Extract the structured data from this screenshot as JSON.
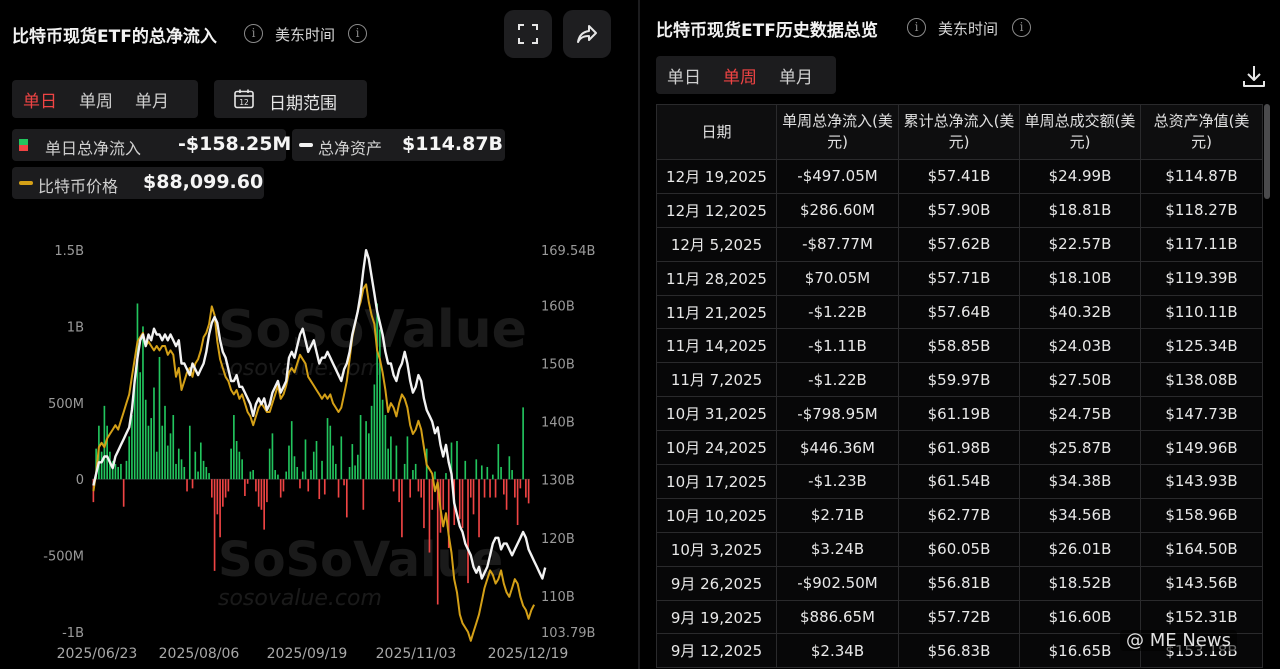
{
  "left": {
    "title": "比特币现货ETF的总净流入",
    "timezone": "美东时间",
    "tabs": [
      "单日",
      "单周",
      "单月"
    ],
    "active_tab": "单日",
    "date_range_label": "日期范围",
    "calendar_icon_text": "12",
    "legend": {
      "flow_label": "单日总净流入",
      "flow_value": "-$158.25M",
      "assets_label": "总净资产",
      "assets_value": "$114.87B",
      "price_label": "比特币价格",
      "price_value": "$88,099.60"
    },
    "watermark": "SoSoValue",
    "watermark_sub": "sosovalue.com"
  },
  "right": {
    "title": "比特币现货ETF历史数据总览",
    "timezone": "美东时间",
    "tabs": [
      "单日",
      "单周",
      "单月"
    ],
    "active_tab": "单周",
    "columns": [
      "日期",
      "单周总净流入(美元)",
      "累计总净流入(美元)",
      "单周总成交额(美元)",
      "总资产净值(美元)"
    ],
    "rows": [
      {
        "date": "12月 19,2025",
        "flow": "-$497.05M",
        "sign": "neg",
        "cum": "$57.41B",
        "vol": "$24.99B",
        "nav": "$114.87B"
      },
      {
        "date": "12月 12,2025",
        "flow": "$286.60M",
        "sign": "pos",
        "cum": "$57.90B",
        "vol": "$18.81B",
        "nav": "$118.27B"
      },
      {
        "date": "12月 5,2025",
        "flow": "-$87.77M",
        "sign": "neg",
        "cum": "$57.62B",
        "vol": "$22.57B",
        "nav": "$117.11B"
      },
      {
        "date": "11月 28,2025",
        "flow": "$70.05M",
        "sign": "pos",
        "cum": "$57.71B",
        "vol": "$18.10B",
        "nav": "$119.39B"
      },
      {
        "date": "11月 21,2025",
        "flow": "-$1.22B",
        "sign": "neg",
        "cum": "$57.64B",
        "vol": "$40.32B",
        "nav": "$110.11B"
      },
      {
        "date": "11月 14,2025",
        "flow": "-$1.11B",
        "sign": "neg",
        "cum": "$58.85B",
        "vol": "$24.03B",
        "nav": "$125.34B"
      },
      {
        "date": "11月 7,2025",
        "flow": "-$1.22B",
        "sign": "neg",
        "cum": "$59.97B",
        "vol": "$27.50B",
        "nav": "$138.08B"
      },
      {
        "date": "10月 31,2025",
        "flow": "-$798.95M",
        "sign": "neg",
        "cum": "$61.19B",
        "vol": "$24.75B",
        "nav": "$147.73B"
      },
      {
        "date": "10月 24,2025",
        "flow": "$446.36M",
        "sign": "pos",
        "cum": "$61.98B",
        "vol": "$25.87B",
        "nav": "$149.96B"
      },
      {
        "date": "10月 17,2025",
        "flow": "-$1.23B",
        "sign": "neg",
        "cum": "$61.54B",
        "vol": "$34.38B",
        "nav": "$143.93B"
      },
      {
        "date": "10月 10,2025",
        "flow": "$2.71B",
        "sign": "pos",
        "cum": "$62.77B",
        "vol": "$34.56B",
        "nav": "$158.96B"
      },
      {
        "date": "10月 3,2025",
        "flow": "$3.24B",
        "sign": "pos",
        "cum": "$60.05B",
        "vol": "$26.01B",
        "nav": "$164.50B"
      },
      {
        "date": "9月 26,2025",
        "flow": "-$902.50M",
        "sign": "neg",
        "cum": "$56.81B",
        "vol": "$18.52B",
        "nav": "$143.56B"
      },
      {
        "date": "9月 19,2025",
        "flow": "$886.65M",
        "sign": "pos",
        "cum": "$57.72B",
        "vol": "$16.60B",
        "nav": "$152.31B"
      },
      {
        "date": "9月 12,2025",
        "flow": "$2.34B",
        "sign": "pos",
        "cum": "$56.83B",
        "vol": "$16.65B",
        "nav": "$153.18B"
      }
    ],
    "watermark": "SoSoValue",
    "watermark_sub": "sosovalue.com",
    "credit": "@ ME News"
  },
  "colors": {
    "inflow": "#22c55e",
    "outflow": "#ef4444",
    "assets_line": "#f2f2f2",
    "price_line": "#d4a017",
    "accent_active": "#ef4444"
  },
  "chart_data": {
    "type": "bar",
    "x_ticks": [
      "2025/06/23",
      "2025/08/06",
      "2025/09/19",
      "2025/11/03",
      "2025/12/19"
    ],
    "left_axis_ticks": [
      "1.5B",
      "1B",
      "500M",
      "0",
      "-500M",
      "-1B"
    ],
    "left_ylim": [
      -1000,
      1500
    ],
    "left_unit": "M",
    "right_axis_ticks": [
      "169.54B",
      "160B",
      "150B",
      "140B",
      "130B",
      "120B",
      "110B",
      "103.79B"
    ],
    "right_axis_values": [
      169.54,
      160,
      150,
      140,
      130,
      120,
      110,
      103.79
    ],
    "right_ylim": [
      103.79,
      169.54
    ],
    "series": [
      {
        "name": "单日总净流入",
        "type": "bar",
        "unit": "M",
        "values": [
          -150,
          200,
          350,
          180,
          480,
          350,
          180,
          120,
          100,
          80,
          100,
          -180,
          120,
          280,
          420,
          620,
          1150,
          700,
          1000,
          520,
          350,
          400,
          600,
          180,
          800,
          350,
          480,
          220,
          300,
          420,
          100,
          200,
          130,
          80,
          -80,
          350,
          -60,
          180,
          50,
          240,
          120,
          80,
          40,
          -120,
          -600,
          -230,
          -380,
          -180,
          -120,
          -80,
          200,
          420,
          250,
          180,
          130,
          -110,
          -30,
          50,
          60,
          -80,
          -180,
          -200,
          -330,
          -150,
          200,
          300,
          60,
          30,
          -120,
          -80,
          50,
          220,
          380,
          150,
          80,
          -60,
          50,
          260,
          -80,
          60,
          180,
          250,
          -130,
          120,
          -100,
          400,
          350,
          220,
          100,
          -120,
          280,
          -40,
          -250,
          80,
          230,
          90,
          160,
          420,
          -200,
          380,
          300,
          480,
          620,
          1150,
          980,
          520,
          420,
          200,
          280,
          -80,
          220,
          -150,
          -380,
          100,
          280,
          -120,
          60,
          100,
          -80,
          -120,
          -320,
          200,
          -480,
          -200,
          50,
          -820,
          -350,
          -200,
          40,
          -450,
          240,
          -300,
          250,
          -260,
          -320,
          120,
          -680,
          -120,
          -230,
          130,
          -380,
          90,
          -120,
          80,
          -120,
          30,
          -120,
          230,
          80,
          -100,
          -200,
          150,
          60,
          -120,
          -300,
          -60,
          470,
          -120,
          -158.25
        ]
      },
      {
        "name": "总净资产",
        "type": "line",
        "unit": "B",
        "values": [
          129,
          131,
          133,
          133,
          134,
          134,
          133,
          132,
          134,
          135,
          136,
          137,
          138,
          139,
          142,
          147,
          151,
          154,
          155,
          153,
          155,
          154,
          156,
          155,
          155,
          154,
          155,
          154,
          155,
          154,
          153,
          154,
          150,
          150,
          149,
          148,
          150,
          149,
          148,
          149,
          150,
          152,
          155,
          157,
          158,
          157,
          154,
          152,
          151,
          149,
          147,
          147,
          148,
          146,
          146,
          145,
          144,
          143,
          141,
          143,
          144,
          143,
          144,
          142,
          143,
          145,
          146,
          147,
          145,
          146,
          147,
          151,
          152,
          151,
          153,
          155,
          156,
          154,
          152,
          153,
          154,
          152,
          150,
          151,
          151,
          152,
          151,
          150,
          149,
          148,
          147,
          149,
          150,
          152,
          155,
          157,
          159,
          162,
          166,
          169.5,
          168,
          165,
          162,
          159,
          157,
          155,
          152,
          150,
          150,
          148,
          147,
          149,
          150,
          152,
          150,
          147,
          145,
          146,
          148,
          147,
          144,
          142,
          141,
          140,
          138,
          139,
          136,
          134,
          136,
          133,
          131,
          126,
          124,
          122,
          121,
          119,
          118,
          117,
          115,
          114,
          115,
          113,
          114,
          115,
          117,
          119,
          120,
          120,
          118,
          119,
          119,
          118,
          117,
          118,
          119,
          120,
          121,
          120,
          118,
          117,
          116,
          115,
          114,
          113,
          114.87
        ]
      },
      {
        "name": "比特币价格",
        "type": "line",
        "unit": "USD",
        "values": [
          101000,
          103000,
          106000,
          106500,
          106000,
          107000,
          107500,
          108000,
          108500,
          108000,
          109000,
          110000,
          111000,
          112000,
          114000,
          116000,
          118000,
          118500,
          119000,
          117500,
          118000,
          117500,
          117000,
          117500,
          117000,
          117500,
          117500,
          116500,
          117000,
          116500,
          114000,
          115000,
          112500,
          113500,
          114500,
          115000,
          114000,
          115500,
          116000,
          117000,
          118500,
          119000,
          120000,
          122000,
          121000,
          118000,
          116000,
          115000,
          114000,
          113500,
          112500,
          112000,
          112500,
          111500,
          112000,
          111000,
          110000,
          109500,
          108500,
          109500,
          110500,
          111000,
          110500,
          110000,
          110000,
          111000,
          112000,
          113000,
          111500,
          112000,
          113000,
          114500,
          115000,
          114500,
          115500,
          116500,
          116000,
          115500,
          114000,
          113500,
          113000,
          112500,
          112000,
          111500,
          112000,
          111500,
          112000,
          111000,
          110500,
          110000,
          110500,
          112000,
          113500,
          116000,
          118500,
          120000,
          121500,
          122500,
          124000,
          124500,
          122500,
          121000,
          120000,
          117000,
          116000,
          114500,
          112500,
          110000,
          111000,
          110500,
          109500,
          111000,
          112000,
          111500,
          110500,
          108500,
          107500,
          108000,
          109000,
          108000,
          106000,
          104000,
          103500,
          103000,
          101000,
          102000,
          99000,
          97000,
          98500,
          96000,
          94000,
          91000,
          89500,
          87000,
          86000,
          85500,
          85000,
          84000,
          85000,
          86000,
          87000,
          88500,
          90000,
          91000,
          92000,
          91500,
          90500,
          91000,
          92000,
          90500,
          89500,
          89000,
          90000,
          91000,
          90500,
          89000,
          88000,
          87500,
          86500,
          87500,
          88099.6
        ]
      }
    ]
  }
}
